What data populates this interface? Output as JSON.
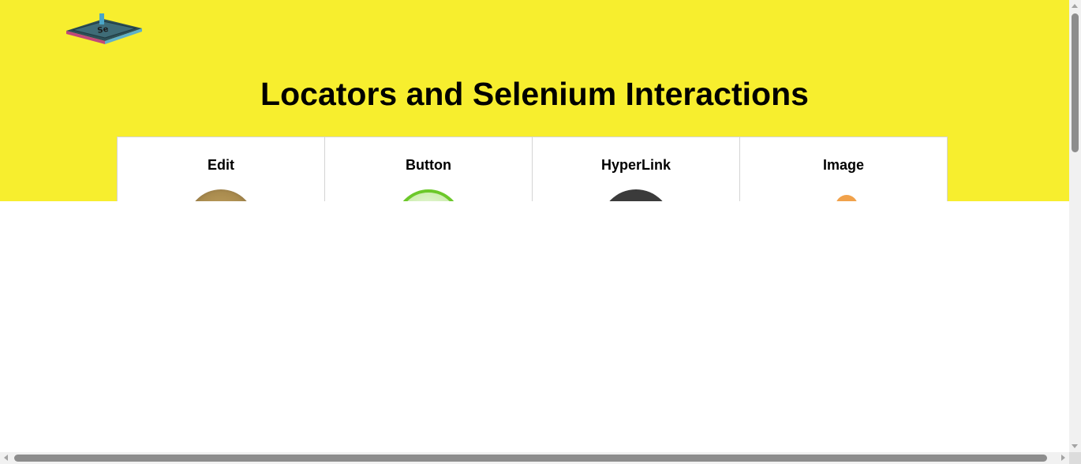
{
  "header": {
    "title": "Locators and Selenium Interactions",
    "logo_icon": "selenium-chip-logo",
    "background_color": "#f7ee2e"
  },
  "cards": [
    {
      "label": "Edit",
      "icon": "edit-icon"
    },
    {
      "label": "Button",
      "icon": "button-icon"
    },
    {
      "label": "HyperLink",
      "icon": "hyperlink-icon"
    },
    {
      "label": "Image",
      "icon": "image-icon"
    }
  ],
  "colors": {
    "accent_yellow": "#f7ee2e",
    "button_green": "#6cc82a",
    "hyperlink_dark": "#3b3b3b",
    "image_orange": "#f1a24b"
  }
}
